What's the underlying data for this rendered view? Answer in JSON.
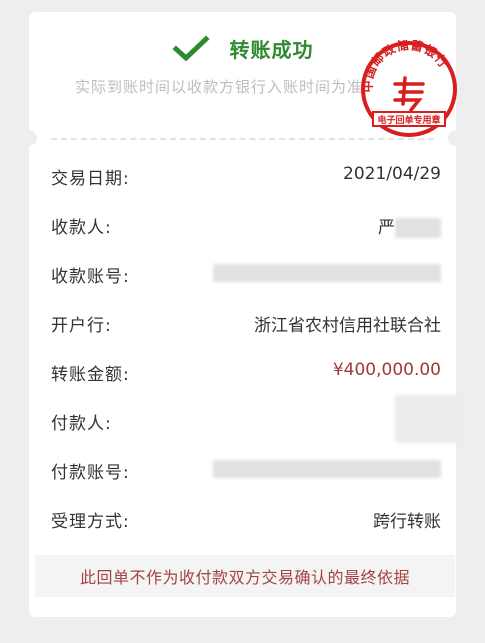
{
  "status": {
    "title": "转账成功",
    "subtitle": "实际到账时间以收款方银行入账时间为准"
  },
  "seal": {
    "bank_name": "中国邮政储蓄银行",
    "caption": "电子回单专用章",
    "color": "#d81e1e"
  },
  "rows": [
    {
      "label": "交易日期:",
      "value": "2021/04/29"
    },
    {
      "label": "收款人:",
      "value": "严"
    },
    {
      "label": "收款账号:",
      "value": ""
    },
    {
      "label": "开户行:",
      "value": "浙江省农村信用社联合社"
    },
    {
      "label": "转账金额:",
      "value": "¥400,000.00"
    },
    {
      "label": "付款人:",
      "value": ""
    },
    {
      "label": "付款账号:",
      "value": ""
    },
    {
      "label": "受理方式:",
      "value": "跨行转账"
    }
  ],
  "notice": "此回单不作为收付款双方交易确认的最终依据",
  "colors": {
    "success": "#2f8a2f",
    "amount": "#a03a3a",
    "notice_text": "#a34444"
  }
}
